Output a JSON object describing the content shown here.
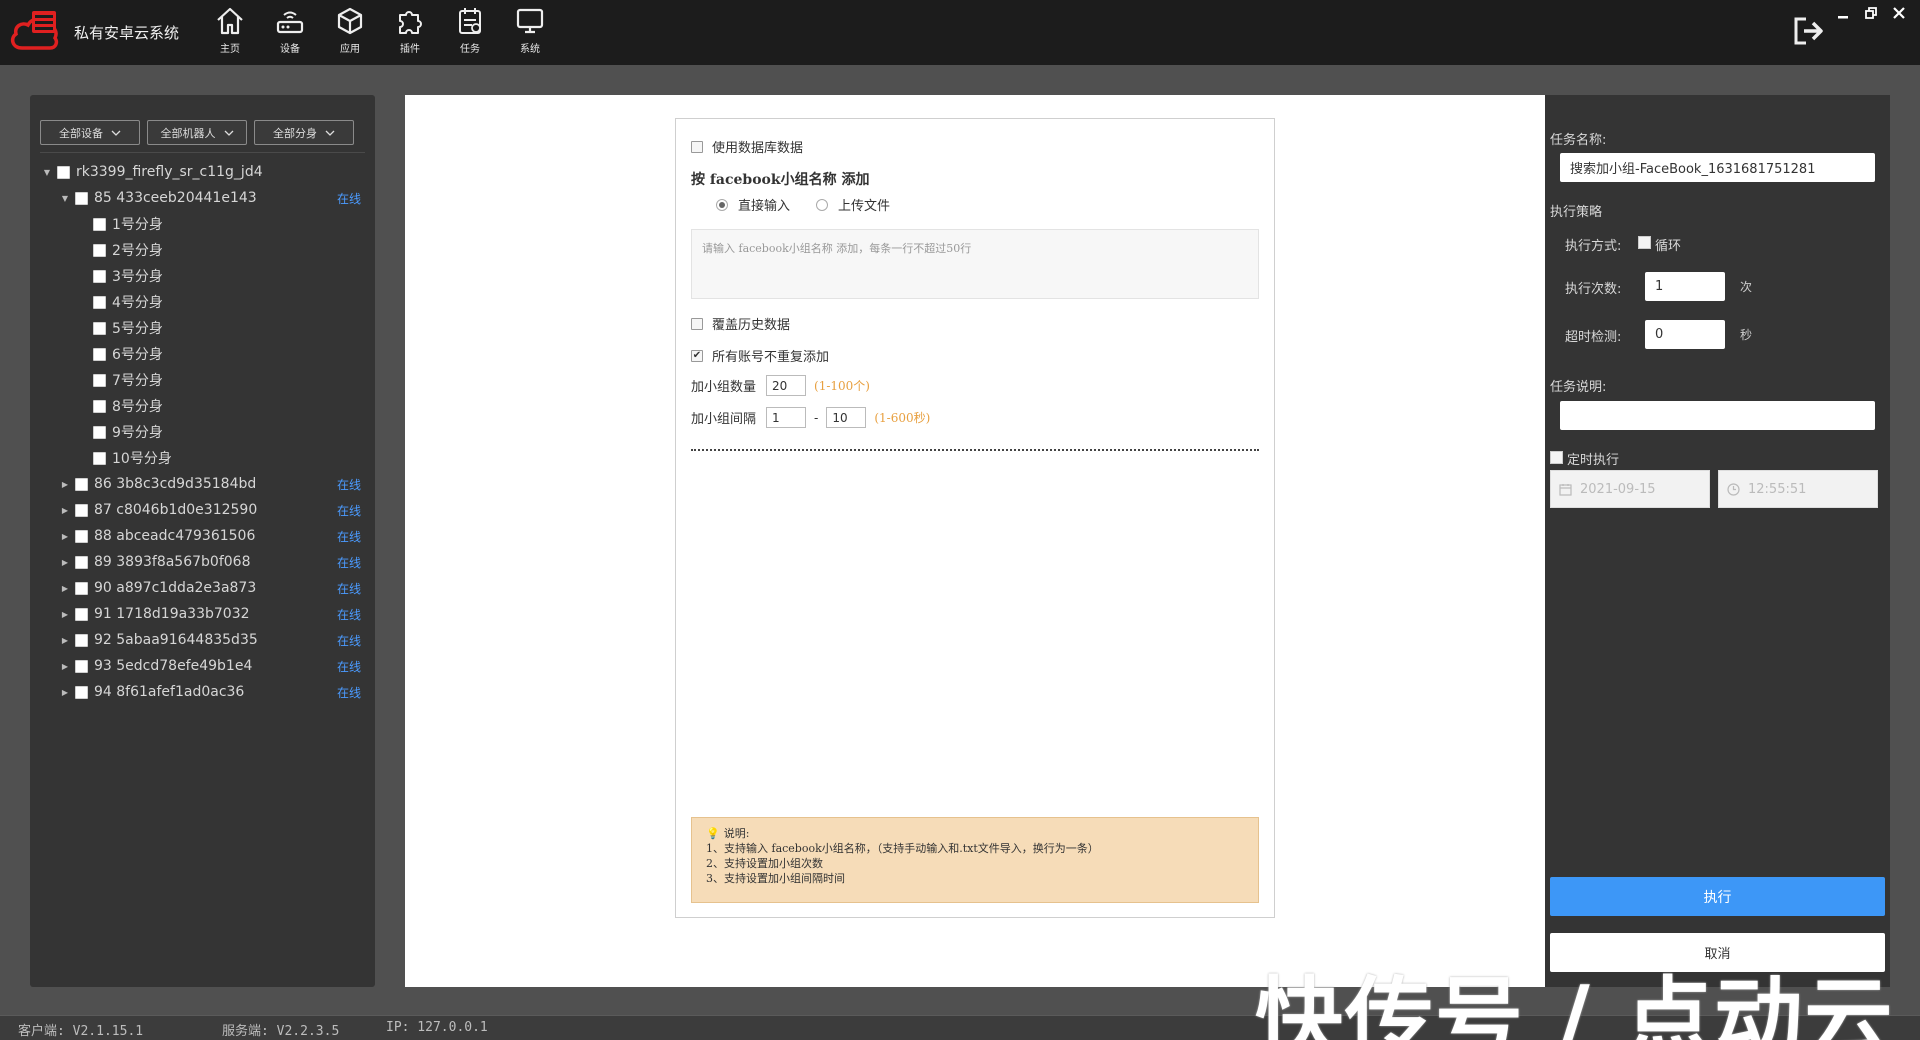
{
  "app": {
    "title": "私有安卓云系统",
    "brand_color": "#e02020"
  },
  "nav": [
    {
      "label": "主页",
      "icon": "home-icon"
    },
    {
      "label": "设备",
      "icon": "router-icon"
    },
    {
      "label": "应用",
      "icon": "cube-icon"
    },
    {
      "label": "插件",
      "icon": "puzzle-icon"
    },
    {
      "label": "任务",
      "icon": "task-icon"
    },
    {
      "label": "系统",
      "icon": "monitor-icon"
    }
  ],
  "filters": {
    "devices": "全部设备",
    "robots": "全部机器人",
    "clones": "全部分身"
  },
  "tree": {
    "root": "rk3399_firefly_sr_c11g_jd4",
    "expanded_device": "85 433ceeb20441e143",
    "online_label": "在线",
    "clones": [
      "1号分身",
      "2号分身",
      "3号分身",
      "4号分身",
      "5号分身",
      "6号分身",
      "7号分身",
      "8号分身",
      "9号分身",
      "10号分身"
    ],
    "devices": [
      "86 3b8c3cd9d35184bd",
      "87 c8046b1d0e312590",
      "88 abceadc479361506",
      "89 3893f8a567b0f068",
      "90 a897c1dda2e3a873",
      "91 1718d19a33b7032",
      "92 5abaa91644835d35",
      "93 5edcd78efe49b1e4",
      "94 8f61afef1ad0ac36"
    ]
  },
  "form": {
    "use_db_label": "使用数据库数据",
    "section_title": "按 facebook小组名称 添加",
    "radio_direct": "直接输入",
    "radio_upload": "上传文件",
    "textarea_placeholder": "请输入 facebook小组名称 添加，每条一行不超过50行",
    "overwrite_label": "覆盖历史数据",
    "no_dup_label": "所有账号不重复添加",
    "no_dup_checkmark": "✔",
    "count_label": "加小组数量",
    "count_value": "20",
    "count_hint": "(1-100个)",
    "interval_label": "加小组间隔",
    "interval_min": "1",
    "interval_dash": "-",
    "interval_max": "10",
    "interval_hint": "(1-600秒)",
    "note": {
      "title": "说明:",
      "lines": [
        "1、支持输入 facebook小组名称，（支持手动输入和.txt文件导入，换行为一条）",
        "2、支持设置加小组次数",
        "3、支持设置加小组间隔时间"
      ]
    }
  },
  "right": {
    "task_name_label": "任务名称:",
    "task_name_value": "搜索加小组-FaceBook_1631681751281",
    "strategy_label": "执行策略",
    "mode_label": "执行方式:",
    "loop_label": "循环",
    "times_label": "执行次数:",
    "times_value": "1",
    "times_unit": "次",
    "timeout_label": "超时检测:",
    "timeout_value": "0",
    "timeout_unit": "秒",
    "desc_label": "任务说明:",
    "scheduled_label": "定时执行",
    "date_value": "2021-09-15",
    "time_value": "12:55:51",
    "run_label": "执行",
    "cancel_label": "取消"
  },
  "status": {
    "client": "客户端: V2.1.15.1",
    "server": "服务端: V2.2.3.5",
    "ip": "IP: 127.0.0.1"
  },
  "watermark": "快传号 / 点动云"
}
